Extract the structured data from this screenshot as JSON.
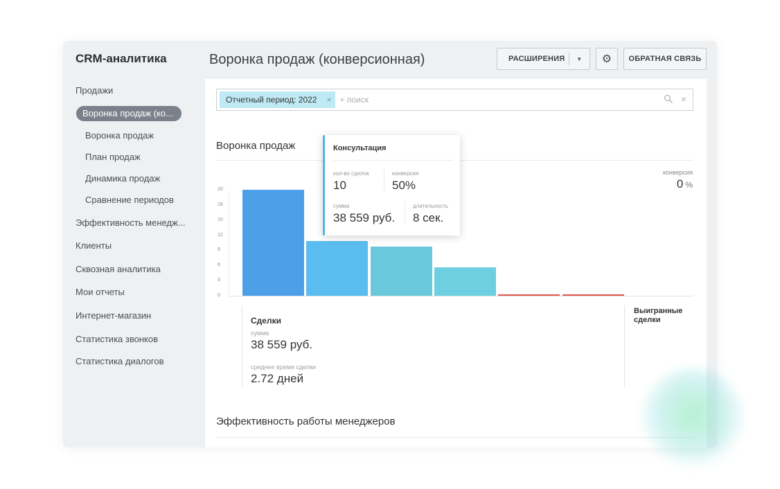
{
  "app": {
    "title": "CRM-аналитика"
  },
  "sidebar": {
    "items": [
      {
        "label": "Продажи"
      },
      {
        "label": "Воронка продаж (ко..."
      },
      {
        "label": "Воронка продаж"
      },
      {
        "label": "План продаж"
      },
      {
        "label": "Динамика продаж"
      },
      {
        "label": "Сравнение периодов"
      },
      {
        "label": "Эффективность менедж..."
      },
      {
        "label": "Клиенты"
      },
      {
        "label": "Сквозная аналитика"
      },
      {
        "label": "Мои отчеты"
      },
      {
        "label": "Интернет-магазин"
      },
      {
        "label": "Статистика звонков"
      },
      {
        "label": "Статистика диалогов"
      }
    ],
    "active_index": 1
  },
  "header": {
    "page_title": "Воронка продаж (конверсионная)",
    "extensions_label": "РАСШИРЕНИЯ",
    "caret_icon": "chevron-down-icon",
    "settings_icon": "gear-icon",
    "feedback_label": "ОБРАТНАЯ СВЯЗЬ"
  },
  "filter": {
    "chip_label": "Отчетный период: 2022",
    "chip_close": "×",
    "placeholder": "+ поиск",
    "search_icon": "search-icon",
    "clear": "×"
  },
  "funnel": {
    "title": "Воронка продаж",
    "conversion_label": "конверсия",
    "conversion_value": "0",
    "conversion_unit": "%"
  },
  "chart_data": {
    "type": "bar",
    "y_ticks": [
      "20",
      "18",
      "15",
      "12",
      "9",
      "6",
      "3",
      "0"
    ],
    "ylim": [
      0,
      20
    ],
    "values": [
      20,
      10.3,
      9.3,
      5.3,
      0,
      0
    ],
    "colors": [
      "#4da0e8",
      "#5bbcf0",
      "#6bc8dc",
      "#6dcfdf",
      "#e2574c",
      "#e2574c"
    ]
  },
  "stats": {
    "title": "Сделки",
    "sum_label": "сумма",
    "sum_value": "38 559 руб.",
    "avg_label": "среднее время сделки",
    "avg_value": "2.72 дней",
    "won_title": "Выигранные сделки"
  },
  "managers": {
    "title": "Эффективность работы менеджеров"
  },
  "tooltip": {
    "title": "Консультация",
    "deals_label": "кол-во сделок",
    "deals_value": "10",
    "conv_label": "конверсия",
    "conv_value": "50%",
    "sum_label": "сумма",
    "sum_value": "38 559 руб.",
    "dur_label": "длительность",
    "dur_value": "8 сек."
  }
}
